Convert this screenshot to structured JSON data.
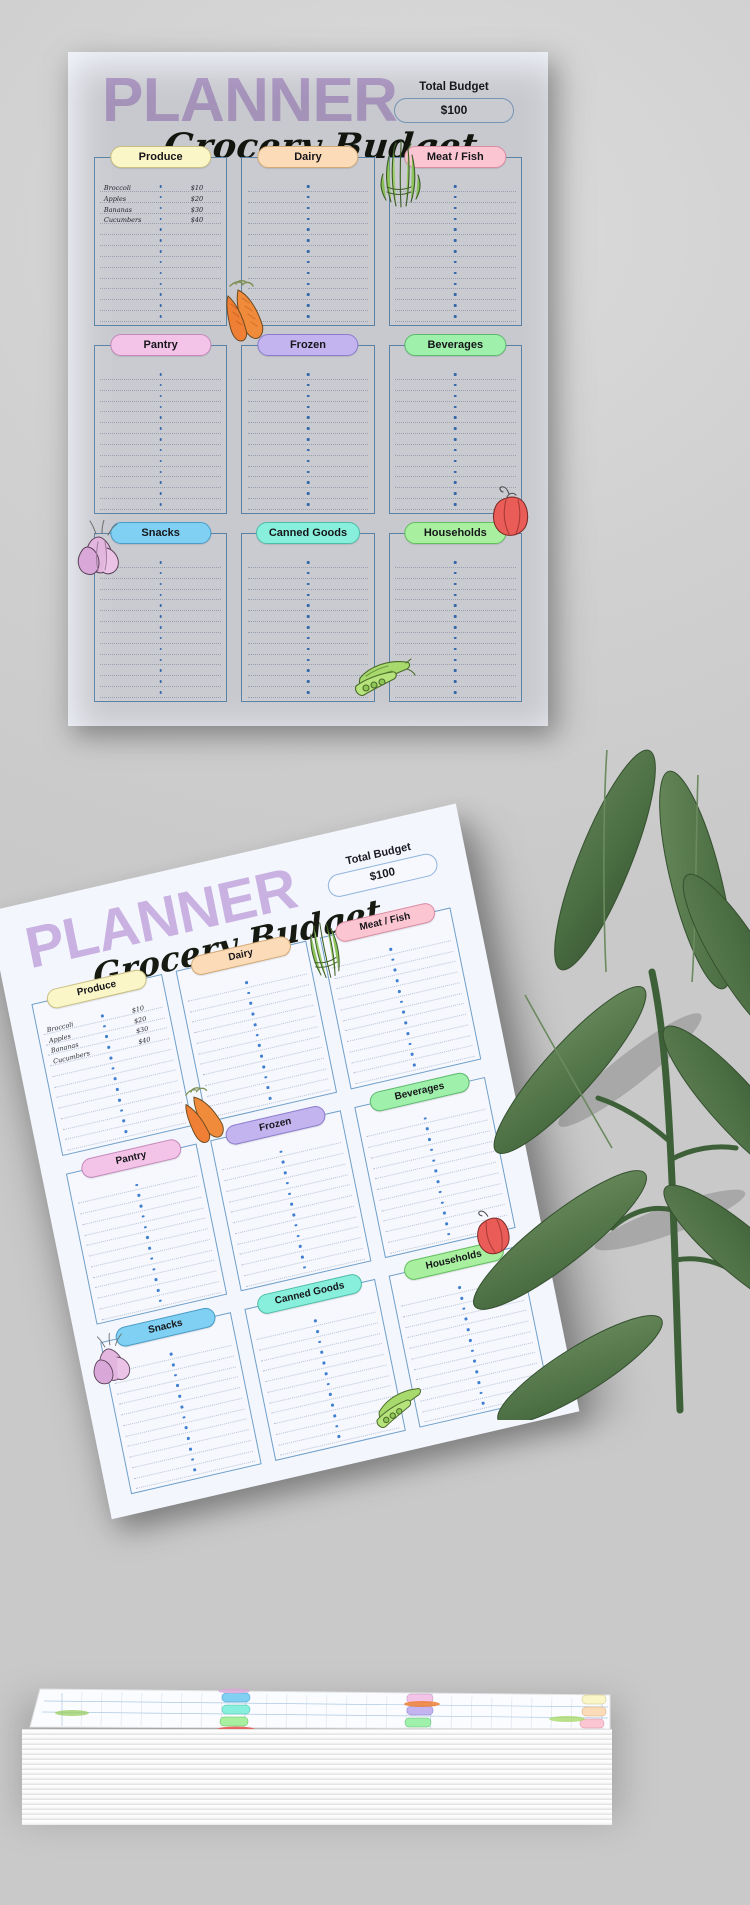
{
  "meta": {
    "background_color": "#d2d2d2",
    "paper_color": "#f4f6fd",
    "card_border_color": "#6f9fc9",
    "dot_color": "#3f7fd0",
    "planner_word_color": "#c9b2e2"
  },
  "header": {
    "planner_word": "PLANNER",
    "script_word": "Grocery Budget",
    "total_budget_label": "Total Budget",
    "total_budget_value": "$100"
  },
  "categories": [
    {
      "label": "Produce",
      "pill_color": "#fbf6c8",
      "pill_border": "#c9bf82"
    },
    {
      "label": "Dairy",
      "pill_color": "#fcdcb8",
      "pill_border": "#d3a875"
    },
    {
      "label": "Meat / Fish",
      "pill_color": "#fbc6d2",
      "pill_border": "#d98ca2"
    },
    {
      "label": "Pantry",
      "pill_color": "#f3c4e8",
      "pill_border": "#c489bb"
    },
    {
      "label": "Frozen",
      "pill_color": "#c3b4ef",
      "pill_border": "#8b7ccd"
    },
    {
      "label": "Beverages",
      "pill_color": "#9ef0ab",
      "pill_border": "#5cb86d"
    },
    {
      "label": "Snacks",
      "pill_color": "#7fd0f2",
      "pill_border": "#4a9cc7"
    },
    {
      "label": "Canned Goods",
      "pill_color": "#88efdc",
      "pill_border": "#4dbca8"
    },
    {
      "label": "Households",
      "pill_color": "#a8f0a0",
      "pill_border": "#62bd5c"
    }
  ],
  "produce_entries": [
    {
      "name": "Broccoli",
      "amount": "$10"
    },
    {
      "name": "Apples",
      "amount": "$20"
    },
    {
      "name": "Bananas",
      "amount": "$30"
    },
    {
      "name": "Cucumbers",
      "amount": "$40"
    }
  ],
  "line_counts": {
    "row1": 13,
    "row2": 13,
    "row3": 13
  },
  "illustrations": [
    {
      "name": "asparagus-bunch-illustration",
      "row": 1
    },
    {
      "name": "carrots-illustration",
      "row": 2
    },
    {
      "name": "garlic-bulb-illustration",
      "row": 3
    },
    {
      "name": "red-bell-pepper-illustration",
      "row": 3
    },
    {
      "name": "pea-pods-illustration",
      "row": 3
    }
  ],
  "scene": {
    "front_sheet_label": "grocery-budget-planner-front-sheet",
    "tilted_sheet_label": "grocery-budget-planner-tilted-sheet",
    "tilted_sheet_rotation_deg": -13,
    "paper_stack_label": "printed-paper-stack",
    "paper_stack_sheet_count": 22,
    "plant_label": "olive-branch-decoration"
  }
}
